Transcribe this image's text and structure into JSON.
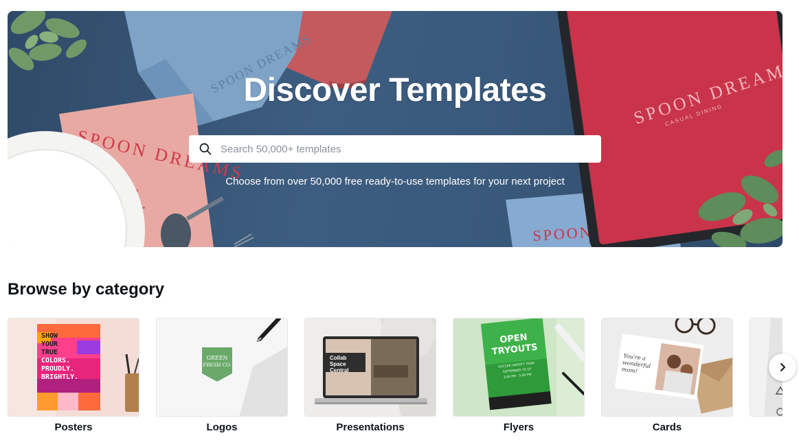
{
  "hero": {
    "title": "Discover Templates",
    "search_placeholder": "Search 50,000+ templates",
    "subtitle": "Choose from over 50,000 free ready-to-use templates for your next project",
    "art": {
      "brand": "SPOON DREAMS",
      "tagline": "CASUAL DINING"
    }
  },
  "browse": {
    "title": "Browse by category",
    "categories": [
      {
        "label": "Posters",
        "art": [
          "SHOW",
          "YOUR",
          "TRUE",
          "COLORS.",
          "PROUDLY.",
          "BRIGHTLY."
        ]
      },
      {
        "label": "Logos",
        "art": [
          "GREEN",
          "FRESH CO."
        ]
      },
      {
        "label": "Presentations",
        "art": [
          "Collab",
          "Space",
          "Central"
        ]
      },
      {
        "label": "Flyers",
        "art": [
          "OPEN",
          "TRYOUTS",
          "SOCCER VARSITY TEAM",
          "SEPTEMBER 15-18",
          "3:00 PM - 5:00 PM"
        ]
      },
      {
        "label": "Cards",
        "art": [
          "You're a",
          "wonderful",
          "mom!"
        ]
      }
    ]
  },
  "colors": {
    "hero_blue": "#3d5d80",
    "accent_red": "#c9344a",
    "text_dark": "#0e1318"
  },
  "icons": {
    "search": "search-icon",
    "next": "chevron-right-icon"
  }
}
